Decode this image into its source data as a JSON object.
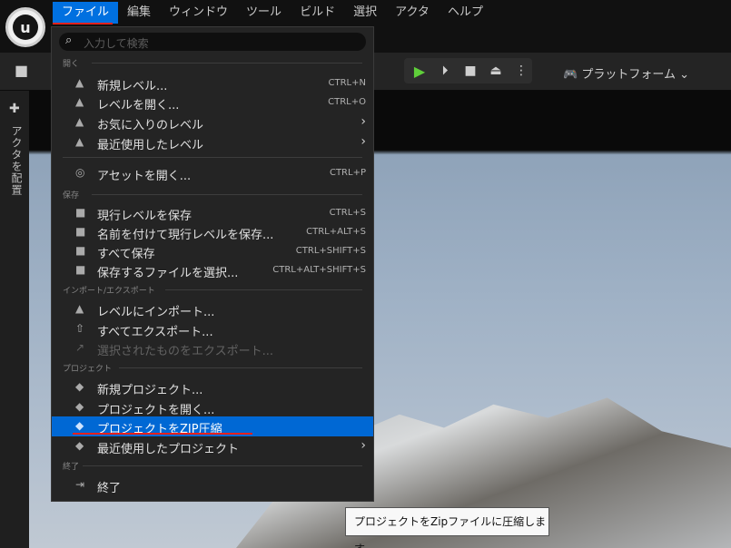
{
  "menubar": {
    "items": [
      "ファイル",
      "編集",
      "ウィンドウ",
      "ツール",
      "ビルド",
      "選択",
      "アクタ",
      "ヘルプ"
    ],
    "active_index": 0
  },
  "search": {
    "placeholder": "入力して検索"
  },
  "toolbar": {
    "platform_label": "プラットフォーム"
  },
  "left_panel": {
    "place_actors": "アクタを配置"
  },
  "sections": {
    "open": "開く",
    "save": "保存",
    "import_export": "インポート/エクスポート",
    "project": "プロジェクト",
    "exit": "終了"
  },
  "menu": {
    "new_level": {
      "label": "新規レベル...",
      "shortcut": "CTRL+N",
      "icon": "new-level-icon"
    },
    "open_level": {
      "label": "レベルを開く...",
      "shortcut": "CTRL+O",
      "icon": "open-level-icon"
    },
    "favorite_levels": {
      "label": "お気に入りのレベル",
      "icon": "favorite-levels-icon"
    },
    "recent_levels": {
      "label": "最近使用したレベル",
      "icon": "recent-levels-icon"
    },
    "open_asset": {
      "label": "アセットを開く...",
      "shortcut": "CTRL+P",
      "icon": "open-asset-icon"
    },
    "save_current_level": {
      "label": "現行レベルを保存",
      "shortcut": "CTRL+S",
      "icon": "save-icon"
    },
    "save_current_level_as": {
      "label": "名前を付けて現行レベルを保存...",
      "shortcut": "CTRL+ALT+S",
      "icon": "save-as-icon"
    },
    "save_all": {
      "label": "すべて保存",
      "shortcut": "CTRL+SHIFT+S",
      "icon": "save-all-icon"
    },
    "choose_files_to_save": {
      "label": "保存するファイルを選択...",
      "shortcut": "CTRL+ALT+SHIFT+S",
      "icon": "choose-files-icon"
    },
    "import_into_level": {
      "label": "レベルにインポート...",
      "icon": "import-icon"
    },
    "export_all": {
      "label": "すべてエクスポート...",
      "icon": "export-icon"
    },
    "export_selected": {
      "label": "選択されたものをエクスポート...",
      "icon": "export-selected-icon"
    },
    "new_project": {
      "label": "新規プロジェクト...",
      "icon": "new-project-icon"
    },
    "open_project": {
      "label": "プロジェクトを開く...",
      "icon": "open-project-icon"
    },
    "zip_project": {
      "label": "プロジェクトをZIP圧縮",
      "icon": "zip-project-icon"
    },
    "recent_projects": {
      "label": "最近使用したプロジェクト",
      "icon": "recent-projects-icon"
    },
    "exit": {
      "label": "終了",
      "icon": "exit-icon"
    }
  },
  "tooltip": "プロジェクトをZipファイルに圧縮します",
  "colors": {
    "accent": "#0070e0",
    "highlight": "#0068d4",
    "annotation": "#e8211c",
    "play": "#5fcf3a"
  }
}
